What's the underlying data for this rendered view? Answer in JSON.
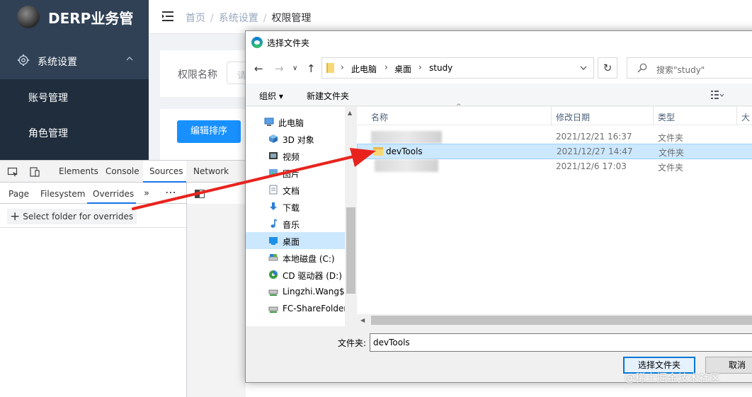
{
  "webapp": {
    "logo_title": "DERP业务管",
    "menu_settings": "系统设置",
    "submenu": [
      "账号管理",
      "角色管理"
    ],
    "breadcrumb": [
      "首页",
      "系统设置",
      "权限管理"
    ],
    "breadcrumb_sep": "/",
    "search_label": "权限名称",
    "search_placeholder": "请",
    "sort_button": "编辑排序",
    "colors": {
      "sidebar": "#304156",
      "submenu": "#1f2d3d",
      "primary": "#1890ff"
    }
  },
  "devtools": {
    "tabs": [
      "Elements",
      "Console",
      "Sources",
      "Network"
    ],
    "active_tab": "Sources",
    "subtabs": [
      "Page",
      "Filesystem",
      "Overrides"
    ],
    "active_subtab": "Overrides",
    "more": "»",
    "dots": "⋯",
    "select_folder": "Select folder for overrides",
    "accent": "#1a73e8"
  },
  "dialog": {
    "title": "选择文件夹",
    "address": [
      "此电脑",
      "桌面",
      "study"
    ],
    "search_placeholder": "搜索\"study\"",
    "toolbar": {
      "organize": "组织 ▾",
      "new_folder": "新建文件夹"
    },
    "nav_tree": [
      {
        "label": "此电脑",
        "icon": "computer-icon"
      },
      {
        "label": "3D 对象",
        "icon": "3d-objects-icon"
      },
      {
        "label": "视频",
        "icon": "video-icon"
      },
      {
        "label": "图片",
        "icon": "pictures-icon"
      },
      {
        "label": "文档",
        "icon": "documents-icon"
      },
      {
        "label": "下载",
        "icon": "download-icon"
      },
      {
        "label": "音乐",
        "icon": "music-icon"
      },
      {
        "label": "桌面",
        "icon": "desktop-icon",
        "selected": true
      },
      {
        "label": "本地磁盘 (C:)",
        "icon": "local-disk-icon"
      },
      {
        "label": "CD 驱动器 (D:)",
        "icon": "cd-drive-icon"
      },
      {
        "label": "Lingzhi.Wang$",
        "icon": "network-drive-icon"
      },
      {
        "label": "FC-ShareFolder",
        "icon": "network-drive-icon"
      }
    ],
    "columns": [
      "名称",
      "修改日期",
      "类型",
      "大"
    ],
    "files": [
      {
        "name": "",
        "date": "2021/12/21 16:37",
        "type": "文件夹",
        "blurred": true
      },
      {
        "name": "devTools",
        "date": "2021/12/27 14:47",
        "type": "文件夹",
        "selected": true
      },
      {
        "name": "",
        "date": "2021/12/6 17:03",
        "type": "文件夹",
        "blurred": true
      }
    ],
    "folder_label": "文件夹:",
    "folder_value": "devTools",
    "select_button": "选择文件夹",
    "cancel_button": "取消"
  },
  "watermark": "@稀土掘金技术社区",
  "annotation_color": "#e8231d"
}
